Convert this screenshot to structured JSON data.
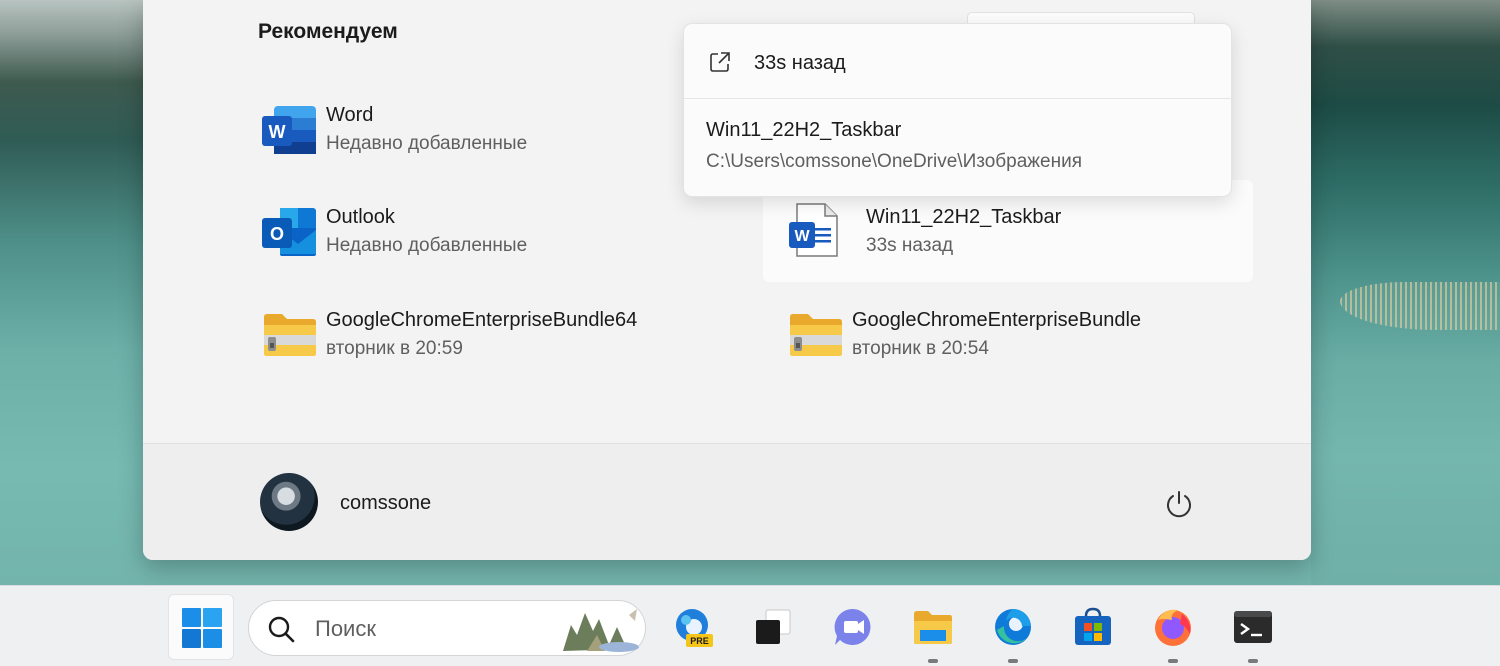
{
  "start_menu": {
    "recommended_title": "Рекомендуем",
    "items": [
      {
        "name": "Word",
        "sub": "Недавно добавленные",
        "icon": "word-icon"
      },
      {
        "name": "Outlook",
        "sub": "Недавно добавленные",
        "icon": "outlook-icon"
      },
      {
        "name": "Win11_22H2_Taskbar",
        "sub": "33s назад",
        "icon": "word-document-icon"
      },
      {
        "name": "GoogleChromeEnterpriseBundle64",
        "sub": "вторник в 20:59",
        "icon": "zip-folder-icon"
      },
      {
        "name": "GoogleChromeEnterpriseBundle",
        "sub": "вторник в 20:54",
        "icon": "zip-folder-icon"
      }
    ],
    "user": {
      "name": "comssone"
    }
  },
  "popup": {
    "open_label": "33s назад",
    "file_name": "Win11_22H2_Taskbar",
    "file_path": "C:\\Users\\comssone\\OneDrive\\Изображения"
  },
  "taskbar": {
    "search_placeholder": "Поиск",
    "apps": [
      "start",
      "search",
      "copilot-edge-pre",
      "task-view",
      "teams-chat",
      "file-explorer",
      "edge",
      "microsoft-store",
      "firefox",
      "terminal"
    ],
    "pre_badge": "PRE"
  },
  "colors": {
    "accent_blue": "#0f6cbd",
    "word_blue": "#185abd",
    "outlook_blue": "#0a64c8",
    "folder_yellow": "#f7c948"
  }
}
